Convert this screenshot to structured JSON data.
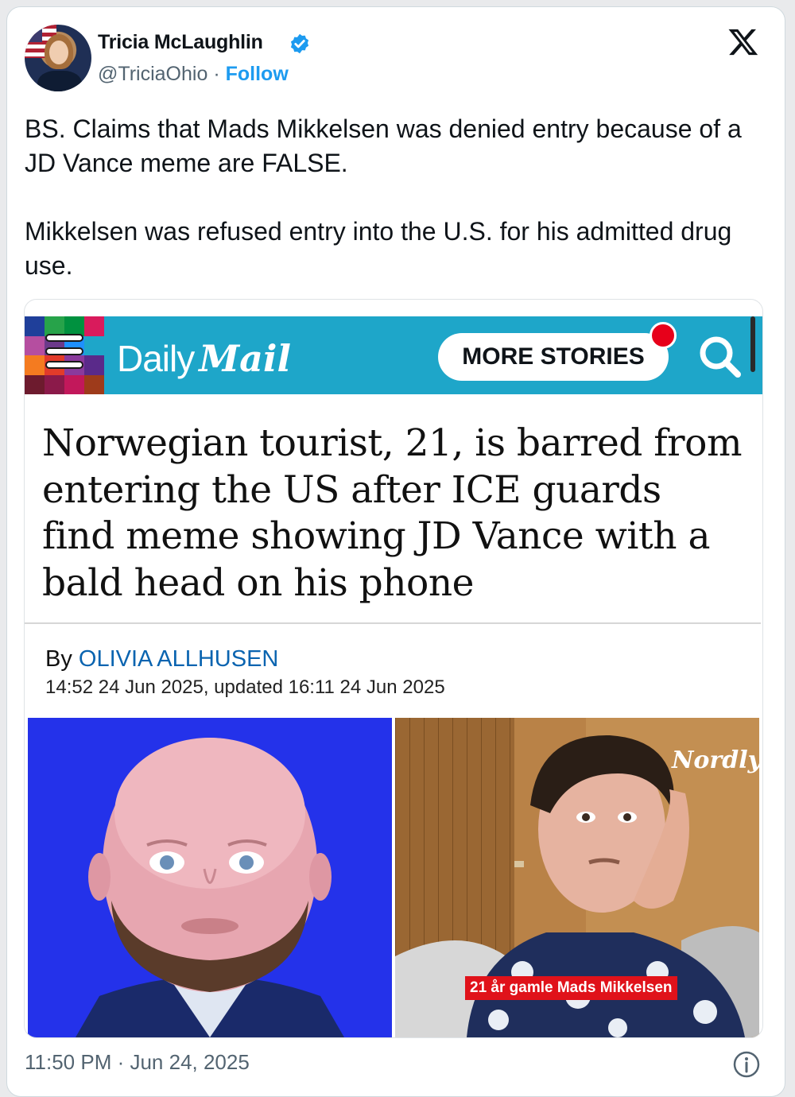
{
  "author": {
    "name": "Tricia McLaughlin",
    "handle": "@TriciaOhio",
    "separator": "·",
    "follow_label": "Follow",
    "verified": true
  },
  "post": {
    "text": "BS. Claims that Mads Mikkelsen was denied entry because of a JD Vance meme are FALSE.\n\nMikkelsen was refused entry into the U.S. for his admitted drug use.",
    "timestamp": "11:50 PM · Jun 24, 2025"
  },
  "embed": {
    "logo_daily": "Daily",
    "logo_mail": "Mail",
    "more_stories_label": "MORE STORIES",
    "headline": "Norwegian tourist, 21, is barred from entering the US after ICE guards find meme showing JD Vance with a bald head on his phone",
    "byline_prefix": "By",
    "author": "OLIVIA ALLHUSEN",
    "dateline": "14:52 24 Jun 2025, updated 16:11 24 Jun 2025",
    "photo_right_watermark": "Nordlys",
    "photo_right_caption": "21 år gamle Mads Mikkelsen"
  },
  "colors": {
    "verified_blue": "#1d9bf0",
    "dailymail_cyan": "#1ea6c9",
    "author_link": "#0a64b0",
    "red_dot": "#e7001a",
    "left_photo_bg": "#2432ea"
  },
  "icons": [
    "verified-badge-icon",
    "x-logo-icon",
    "hamburger-menu-icon",
    "search-icon",
    "info-icon"
  ]
}
